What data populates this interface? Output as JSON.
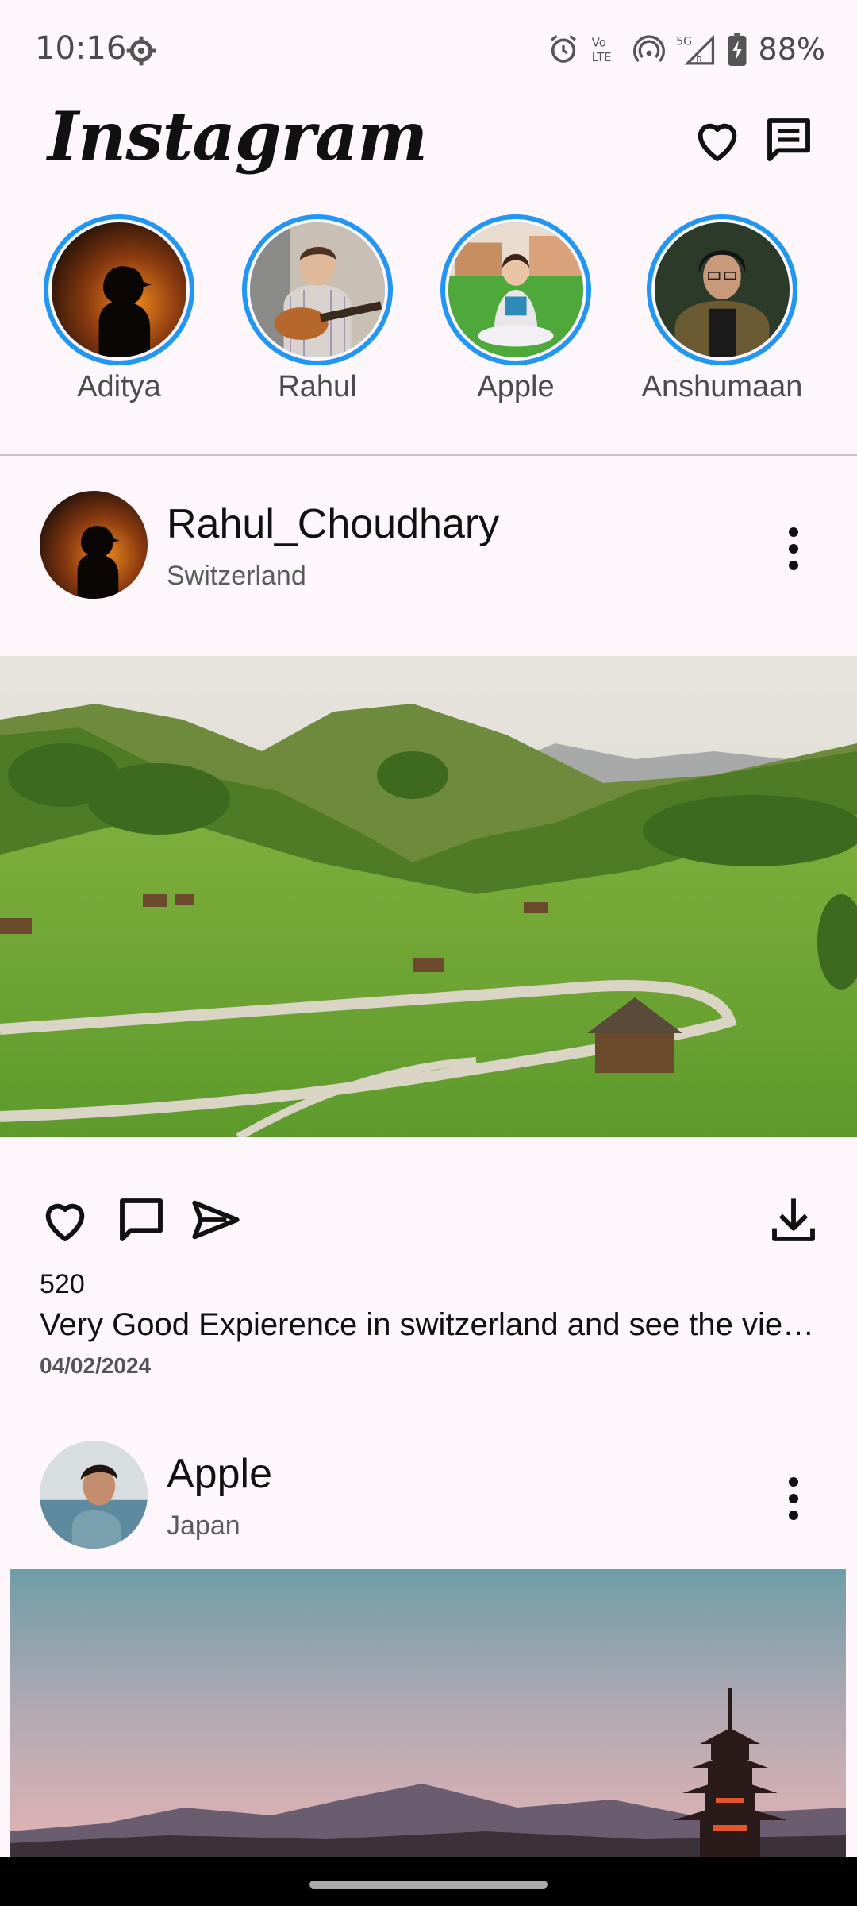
{
  "status_bar": {
    "time": "10:16",
    "battery": "88%",
    "icons": [
      "settings-icon",
      "alarm-icon",
      "volte-icon",
      "hotspot-icon",
      "5g-signal-icon",
      "battery-icon"
    ]
  },
  "header": {
    "logo": "Instagram",
    "icons": [
      "heart-icon",
      "messages-icon"
    ]
  },
  "stories": [
    {
      "name": "Aditya"
    },
    {
      "name": "Rahul"
    },
    {
      "name": "Apple"
    },
    {
      "name": "Anshumaan"
    }
  ],
  "posts": [
    {
      "username": "Rahul_Choudhary",
      "location": "Switzerland",
      "likes": "520",
      "caption": "Very Good Expierence in switzerland and see the view of the mountains",
      "date": "04/02/2024"
    },
    {
      "username": "Apple",
      "location": "Japan"
    }
  ],
  "colors": {
    "background": "#fdf7fb",
    "story_ring": "#2196f3",
    "text": "#111111"
  }
}
